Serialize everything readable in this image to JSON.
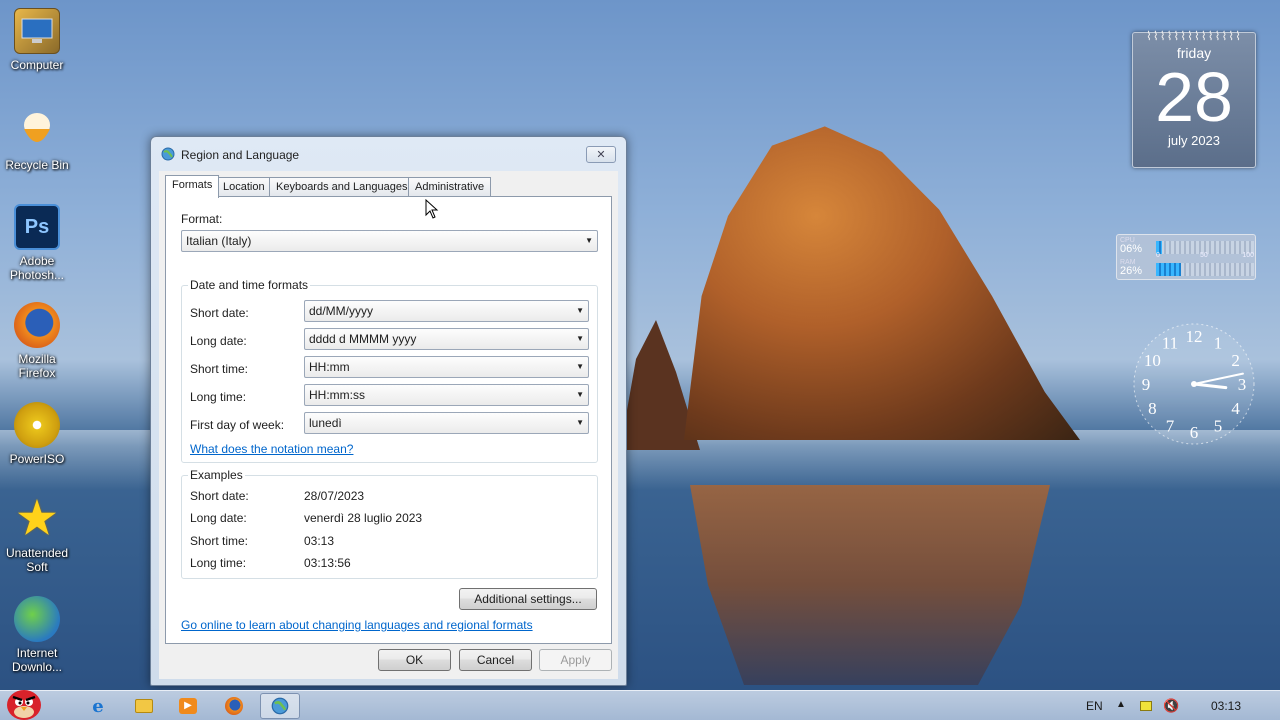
{
  "desktop": {
    "icons": [
      {
        "label": "Computer"
      },
      {
        "label": "Recycle Bin"
      },
      {
        "label": "Adobe Photosh...",
        "glyph": "Ps"
      },
      {
        "label": "Mozilla Firefox"
      },
      {
        "label": "PowerISO"
      },
      {
        "label": "Unattended Soft"
      },
      {
        "label": "Internet Downlo..."
      }
    ]
  },
  "gadgets": {
    "calendar": {
      "weekday": "friday",
      "day": "28",
      "month_year": "july 2023"
    },
    "cpu_meter": {
      "cpu_label": "CPU",
      "cpu_value": "06%",
      "cpu_fraction": 0.06,
      "ram_label": "RAM",
      "ram_value": "26%",
      "ram_fraction": 0.26,
      "scale": [
        "0",
        "50",
        "100"
      ]
    },
    "clock": {
      "numerals": [
        "12",
        "1",
        "2",
        "3",
        "4",
        "5",
        "6",
        "7",
        "8",
        "9",
        "10",
        "11"
      ],
      "hour": 3,
      "minute": 13
    }
  },
  "dialog": {
    "title": "Region and Language",
    "close_glyph": "✕",
    "tabs": [
      {
        "label": "Formats",
        "active": true
      },
      {
        "label": "Location",
        "active": false
      },
      {
        "label": "Keyboards and Languages",
        "active": false
      },
      {
        "label": "Administrative",
        "active": false
      }
    ],
    "format": {
      "label": "Format:",
      "value": "Italian (Italy)"
    },
    "date_time": {
      "title": "Date and time formats",
      "short_date": {
        "label": "Short date:",
        "value": "dd/MM/yyyy"
      },
      "long_date": {
        "label": "Long date:",
        "value": "dddd d MMMM yyyy"
      },
      "short_time": {
        "label": "Short time:",
        "value": "HH:mm"
      },
      "long_time": {
        "label": "Long time:",
        "value": "HH:mm:ss"
      },
      "first_day": {
        "label": "First day of week:",
        "value": "lunedì"
      },
      "notation_link": "What does the notation mean?"
    },
    "examples": {
      "title": "Examples",
      "short_date": {
        "label": "Short date:",
        "value": "28/07/2023"
      },
      "long_date": {
        "label": "Long date:",
        "value": "venerdì 28 luglio 2023"
      },
      "short_time": {
        "label": "Short time:",
        "value": "03:13"
      },
      "long_time": {
        "label": "Long time:",
        "value": "03:13:56"
      }
    },
    "additional_settings": "Additional settings...",
    "online_link": "Go online to learn about changing languages and regional formats",
    "ok": "OK",
    "cancel": "Cancel",
    "apply": "Apply"
  },
  "taskbar": {
    "language": "EN",
    "time": "03:13"
  }
}
